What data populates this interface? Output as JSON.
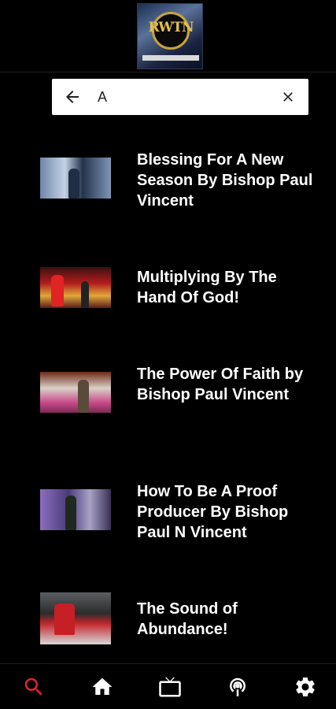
{
  "header": {
    "logo_text": "RWTN",
    "logo_icon": "rwtn-logo"
  },
  "search": {
    "value": "A",
    "back_icon": "arrow-left-icon",
    "clear_icon": "close-icon"
  },
  "results": [
    {
      "title": "Blessing For A New Season By Bishop Paul Vincent"
    },
    {
      "title": "Multiplying By The Hand Of God!"
    },
    {
      "title": "The Power Of Faith by Bishop Paul Vincent"
    },
    {
      "title": "How To Be A Proof Producer By Bishop Paul N Vincent"
    },
    {
      "title": "The Sound of Abundance!"
    }
  ],
  "bottom_nav": [
    {
      "name": "search",
      "icon": "search-icon",
      "color": "#e0262b",
      "active": true
    },
    {
      "name": "home",
      "icon": "home-icon",
      "color": "#ffffff"
    },
    {
      "name": "tv",
      "icon": "tv-icon",
      "color": "#ffffff"
    },
    {
      "name": "podcast",
      "icon": "podcast-icon",
      "color": "#ffffff"
    },
    {
      "name": "settings",
      "icon": "gear-icon",
      "color": "#ffffff"
    }
  ]
}
